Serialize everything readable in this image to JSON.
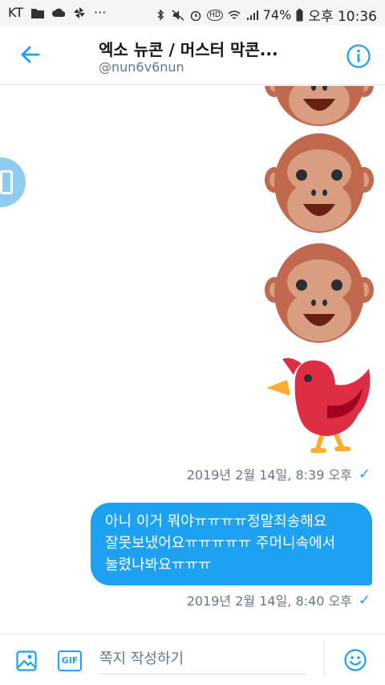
{
  "status_bar": {
    "carrier": "KT",
    "dots": "···",
    "battery": "74%",
    "time": "오후 10:36",
    "hd_label": "HD"
  },
  "header": {
    "title": "엑소 뉴콘 / 머스터 막콘...",
    "handle": "@nun6v6nun"
  },
  "messages": [
    {
      "timestamp": "2019년 2월 14일, 8:39 오후",
      "status_icon": "checkmark"
    },
    {
      "text_lines": [
        "아니 이거 뭐야ㅠㅠㅠㅠ정말죄송해요",
        "잘못보냈어요ㅠㅠㅠㅠㅠ 주머니속에서",
        "눌렸나봐요ㅠㅠㅠ"
      ],
      "timestamp": "2019년 2월 14일, 8:40 오후",
      "status_icon": "checkmark"
    }
  ],
  "emoji_icons": [
    "monkey-face",
    "monkey-face",
    "monkey-face",
    "red-bird"
  ],
  "composer": {
    "gif_label": "GIF",
    "placeholder": "쪽지 작성하기"
  },
  "colors": {
    "accent": "#1da1f2",
    "monkey_fur": "#c1694f",
    "monkey_face": "#d99e82",
    "bird": "#dd2e44",
    "bird_feet": "#ffac33"
  }
}
